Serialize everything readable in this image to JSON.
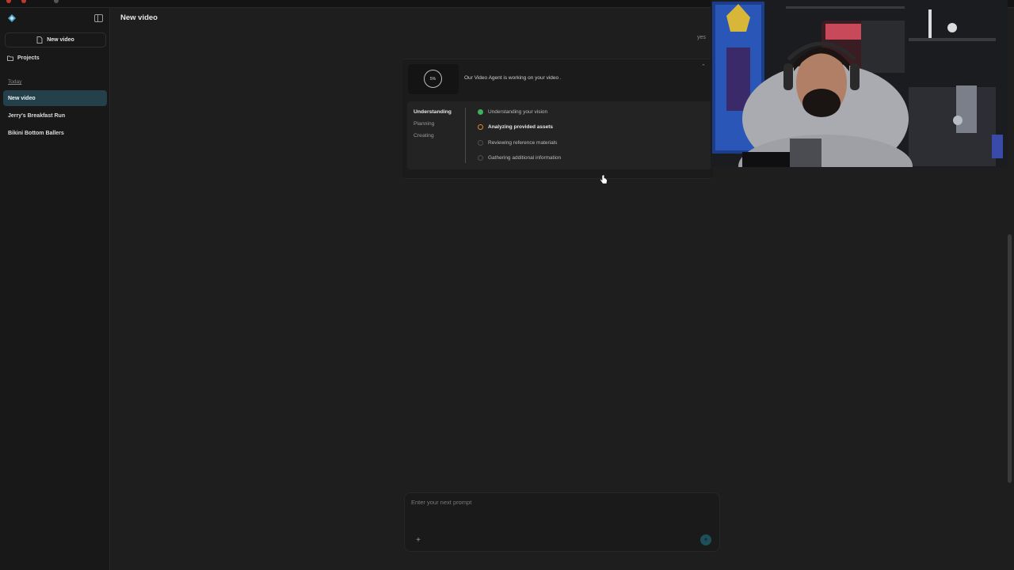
{
  "app": {
    "page_title": "New video"
  },
  "sidebar": {
    "new_video_label": "New video",
    "projects_label": "Projects",
    "section_today": "Today",
    "items": [
      {
        "label": "New video",
        "active": true
      },
      {
        "label": "Jerry's Breakfast Run",
        "active": false
      },
      {
        "label": "Bikini Bottom Ballers",
        "active": false
      }
    ]
  },
  "chat": {
    "user_message": "yes",
    "agent": {
      "progress_label": "5%",
      "progress_value": 0.05,
      "status_text": "Our Video Agent is working on your video .",
      "phases": [
        {
          "label": "Understanding",
          "state": "current"
        },
        {
          "label": "Planning",
          "state": "pending"
        },
        {
          "label": "Creating",
          "state": "pending"
        }
      ],
      "tasks": [
        {
          "label": "Understanding your vision",
          "state": "done"
        },
        {
          "label": "Analyzing provided assets",
          "state": "active"
        },
        {
          "label": "Reviewing reference materials",
          "state": "pending"
        },
        {
          "label": "Gathering additional information",
          "state": "pending"
        }
      ]
    }
  },
  "composer": {
    "placeholder": "Enter your next prompt"
  },
  "icons": {
    "logo": "logo-icon",
    "sidebar_toggle": "sidebar-toggle-icon",
    "new_video": "new-document-icon",
    "projects": "folder-icon",
    "collapse": "chevron-up-icon",
    "add": "plus-icon",
    "send": "send-icon",
    "cursor": "hand-cursor-icon"
  },
  "colors": {
    "background": "#1e1e1f",
    "sidebar": "#181818",
    "active_item": "#24404a",
    "done": "#3cb35a",
    "in_progress": "#d98a2b",
    "send_button": "#1f4f58"
  }
}
